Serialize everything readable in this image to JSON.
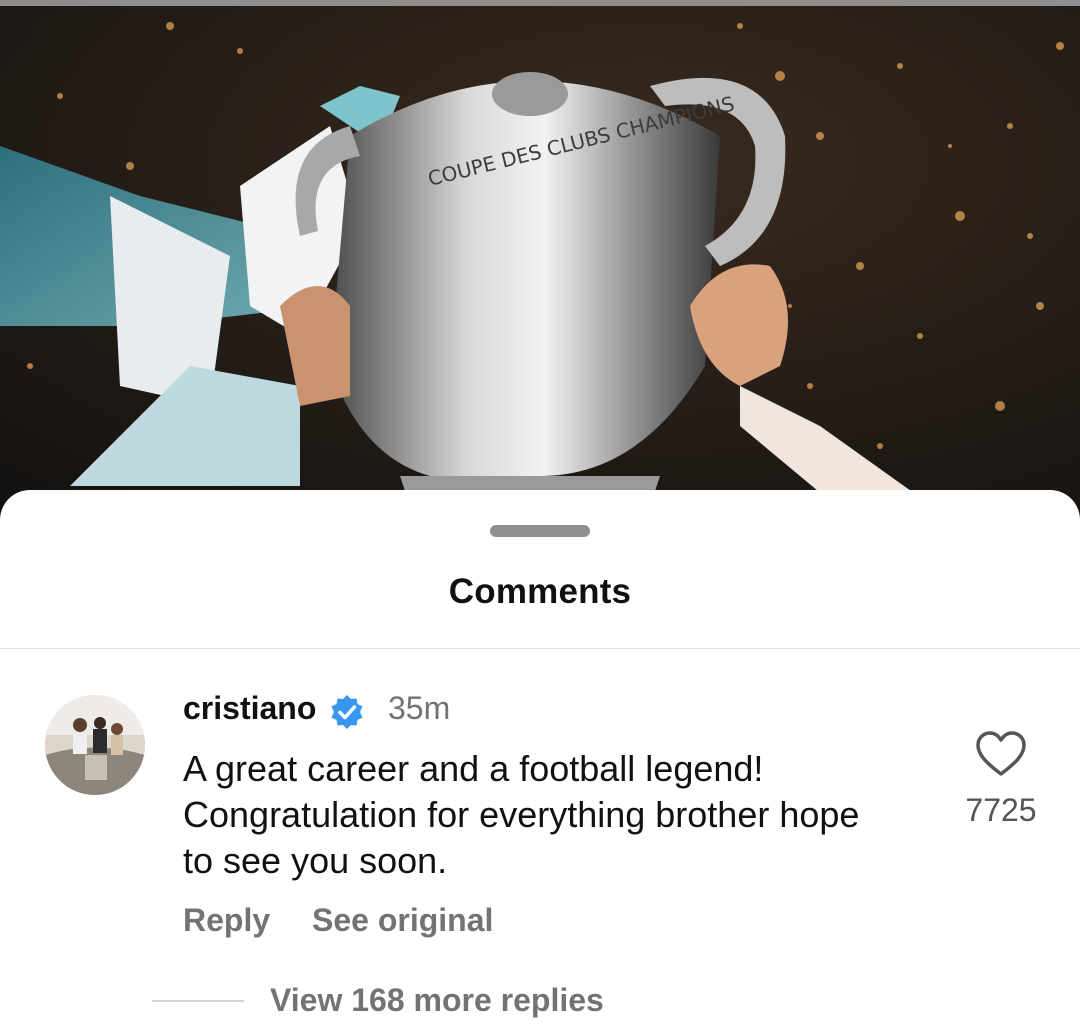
{
  "post": {
    "image_icon": "trophy-photo",
    "trophy_engraving": "COUPE DES CLUBS CHAMPIONS EUROPÉENS"
  },
  "sheet": {
    "title": "Comments",
    "handle_icon": "drag-handle"
  },
  "comment": {
    "username": "cristiano",
    "verified_icon": "verified-badge-icon",
    "time": "35m",
    "text_lines": [
      "A great career and a football legend!",
      "Congratulation for everything brother hope",
      "to see you soon."
    ],
    "like_icon": "heart-outline-icon",
    "like_count": "7725",
    "reply_label": "Reply",
    "see_original_label": "See original"
  },
  "replies": {
    "view_more_label": "View 168 more replies"
  },
  "colors": {
    "verified_blue": "#3897f0",
    "text_primary": "#111111",
    "text_secondary": "#737373"
  }
}
